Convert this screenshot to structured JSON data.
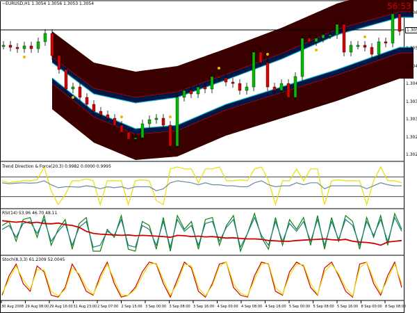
{
  "header": {
    "symbol_info": "~EURUSD,H1 1.3054 1.3056 1.3053 1.3054"
  },
  "timer": "56:53",
  "current_price": "1.3054",
  "price_axis": [
    "1.3065",
    "1.3055",
    "1.3050",
    "1.3045",
    "1.3040",
    "1.3035",
    "1.3030",
    "1.3025",
    "1.3020"
  ],
  "time_axis": [
    "30 Aug 2008",
    "29 Aug 08:00",
    "29 Aug 16:00",
    "31 Aug 23:00",
    "2 Sep 07:00",
    "2 Sep 15:00",
    "3 Sep 00:00",
    "3 Sep 08:00",
    "3 Sep 16:00",
    "4 Sep 00:00",
    "4 Sep 08:00",
    "4 Sep 16:00",
    "5 Sep 00:00",
    "5 Sep 08:00",
    "5 Sep 16:00",
    "8 Sep 00:00",
    "8 Sep 08:00"
  ],
  "subwindows": [
    {
      "title": "Trend Direction & Force(20,3) 0.9982 0.0000 0.9995"
    },
    {
      "title": "RSI(14) 53.96 46.70 48.11"
    },
    {
      "title": "Stoch(8,3,3) 61.2309 52.0045"
    }
  ],
  "colors": {
    "bull": "#00c000",
    "bear": "#e00000",
    "band_fill": "#3a0000",
    "band_inner": "#001848",
    "band_edge": "#19b5c8",
    "band_outer_edge": "#c00000",
    "gold": "#f0b400",
    "yellow": "#e8e000",
    "teal": "#1a8080",
    "green": "#108010",
    "red": "#d00000"
  },
  "chart_data": [
    {
      "type": "candlestick",
      "title": "",
      "price_range": [
        1.3018,
        1.3068
      ],
      "close": [
        1.30556,
        1.3055,
        1.30546,
        1.30554,
        1.30546,
        1.30566,
        1.3059,
        1.30526,
        1.30486,
        1.3043,
        1.30436,
        1.30406,
        1.30386,
        1.30366,
        1.30356,
        1.30346,
        1.30326,
        1.30306,
        1.30286,
        1.3029,
        1.3033,
        1.30342,
        1.30346,
        1.30326,
        1.30266,
        1.30406,
        1.30426,
        1.30416,
        1.30436,
        1.3043,
        1.30466,
        1.30462,
        1.3045,
        1.30446,
        1.30426,
        1.30436,
        1.30536,
        1.30506,
        1.30436,
        1.30426,
        1.30446,
        1.30406,
        1.30466,
        1.30576,
        1.30566,
        1.30576,
        1.30586,
        1.30586,
        1.30616,
        1.30536,
        1.30556,
        1.30556,
        1.3055,
        1.3053,
        1.30566,
        1.30562,
        1.30646,
        1.30596
      ],
      "upper_band": {
        "index": [
          7,
          13,
          19,
          25,
          32,
          40,
          48,
          57
        ],
        "inner": [
          1.30506,
          1.30416,
          1.3039,
          1.30406,
          1.30456,
          1.30516,
          1.30586,
          1.30636
        ],
        "width": 0.0009
      },
      "lower_band": {
        "index": [
          7,
          13,
          19,
          25,
          32,
          40,
          48,
          57
        ],
        "inner": [
          1.30462,
          1.30366,
          1.30316,
          1.30326,
          1.30386,
          1.30436,
          1.30486,
          1.3055
        ],
        "width": 0.0009
      },
      "horizontal_line": 1.306
    },
    {
      "type": "line",
      "range": [
        -1,
        1
      ],
      "levels": [
        0.5,
        -0.5
      ],
      "series": [
        {
          "color": "yellow",
          "values": [
            0.3,
            0.2,
            0.25,
            0.3,
            0.3,
            0.35,
            1,
            -0.2,
            -0.9,
            -0.4,
            0.3,
            0.3,
            0.4,
            0.3,
            -0.9,
            0.3,
            0.3,
            0.3,
            -0.9,
            0.3,
            0.35,
            0.3,
            -0.7,
            -0.9,
            0.9,
            1,
            0.9,
            0.9,
            0.2,
            0.9,
            0.9,
            1,
            0.3,
            0.3,
            0.35,
            0.3,
            0.9,
            1,
            0.3,
            -0.9,
            0.3,
            0.3,
            0.9,
            0.3,
            0.9,
            0.9,
            -0.9,
            0.3,
            0.35,
            0.3,
            0.3,
            0.3,
            -0.9,
            0.3,
            1,
            0.3,
            0.3,
            0.2
          ]
        },
        {
          "color": "slate",
          "values": [
            0.2,
            0.15,
            0.18,
            0.2,
            0.18,
            0.2,
            0.3,
            0.1,
            -0.05,
            0,
            0,
            -0.02,
            0.05,
            0,
            -0.1,
            0,
            -0.05,
            0,
            -0.1,
            0,
            0,
            0,
            -0.2,
            -0.1,
            0.2,
            0.3,
            0.25,
            0.2,
            0.1,
            0.2,
            0.1,
            0.1,
            0.05,
            0.05,
            0,
            0,
            0.2,
            0.3,
            0.1,
            0,
            0.05,
            0.05,
            0.2,
            0.1,
            0.2,
            0.2,
            -0.1,
            0.05,
            0.05,
            0.05,
            0.05,
            0.05,
            -0.1,
            0.05,
            0.2,
            0.1,
            0.05,
            0.05
          ]
        }
      ]
    },
    {
      "type": "line",
      "range": [
        0,
        100
      ],
      "series": [
        {
          "color": "green",
          "values": [
            70,
            80,
            30,
            85,
            90,
            40,
            95,
            20,
            60,
            85,
            10,
            75,
            90,
            5,
            5,
            60,
            40,
            95,
            10,
            5,
            80,
            70,
            10,
            90,
            5,
            95,
            60,
            80,
            10,
            85,
            90,
            20,
            70,
            95,
            5,
            50,
            100,
            40,
            10,
            90,
            20,
            85,
            60,
            90,
            20,
            95,
            10,
            90,
            30,
            95,
            80,
            10,
            90,
            40,
            95,
            20,
            100,
            60
          ]
        },
        {
          "color": "teal",
          "values": [
            60,
            70,
            40,
            75,
            80,
            50,
            85,
            30,
            55,
            75,
            20,
            65,
            80,
            15,
            20,
            55,
            45,
            85,
            20,
            15,
            70,
            60,
            20,
            80,
            15,
            85,
            55,
            70,
            20,
            75,
            80,
            30,
            65,
            85,
            15,
            50,
            90,
            45,
            20,
            80,
            30,
            75,
            55,
            80,
            30,
            85,
            20,
            80,
            35,
            85,
            70,
            20,
            80,
            45,
            85,
            30,
            90,
            55
          ]
        },
        {
          "color": "red",
          "values": [
            82,
            80,
            78,
            80,
            76,
            78,
            75,
            74,
            76,
            72,
            70,
            65,
            55,
            50,
            48,
            47,
            46,
            45,
            46,
            44,
            45,
            44,
            43,
            42,
            40,
            45,
            44,
            42,
            43,
            41,
            42,
            40,
            38,
            39,
            37,
            36,
            36,
            35,
            32,
            31,
            30,
            30,
            32,
            33,
            34,
            35,
            36,
            34,
            33,
            35,
            30,
            28,
            27,
            25,
            20,
            28,
            30,
            32
          ]
        }
      ]
    },
    {
      "type": "line",
      "range": [
        0,
        100
      ],
      "series": [
        {
          "color": "red",
          "values": [
            10,
            60,
            90,
            40,
            20,
            85,
            70,
            10,
            5,
            30,
            90,
            60,
            20,
            10,
            60,
            95,
            40,
            5,
            10,
            30,
            70,
            95,
            90,
            40,
            5,
            50,
            95,
            80,
            20,
            5,
            40,
            90,
            95,
            30,
            10,
            5,
            60,
            95,
            90,
            20,
            10,
            70,
            95,
            85,
            30,
            10,
            80,
            95,
            60,
            20,
            5,
            90,
            95,
            40,
            10,
            60,
            95,
            30
          ]
        },
        {
          "color": "yellow",
          "values": [
            15,
            50,
            85,
            50,
            25,
            75,
            75,
            20,
            8,
            25,
            80,
            65,
            30,
            12,
            50,
            90,
            50,
            10,
            10,
            25,
            60,
            90,
            92,
            50,
            10,
            40,
            90,
            85,
            30,
            8,
            35,
            85,
            95,
            40,
            15,
            8,
            50,
            90,
            92,
            30,
            12,
            60,
            90,
            88,
            40,
            12,
            70,
            90,
            65,
            30,
            8,
            80,
            95,
            50,
            15,
            50,
            90,
            40
          ]
        }
      ]
    }
  ]
}
